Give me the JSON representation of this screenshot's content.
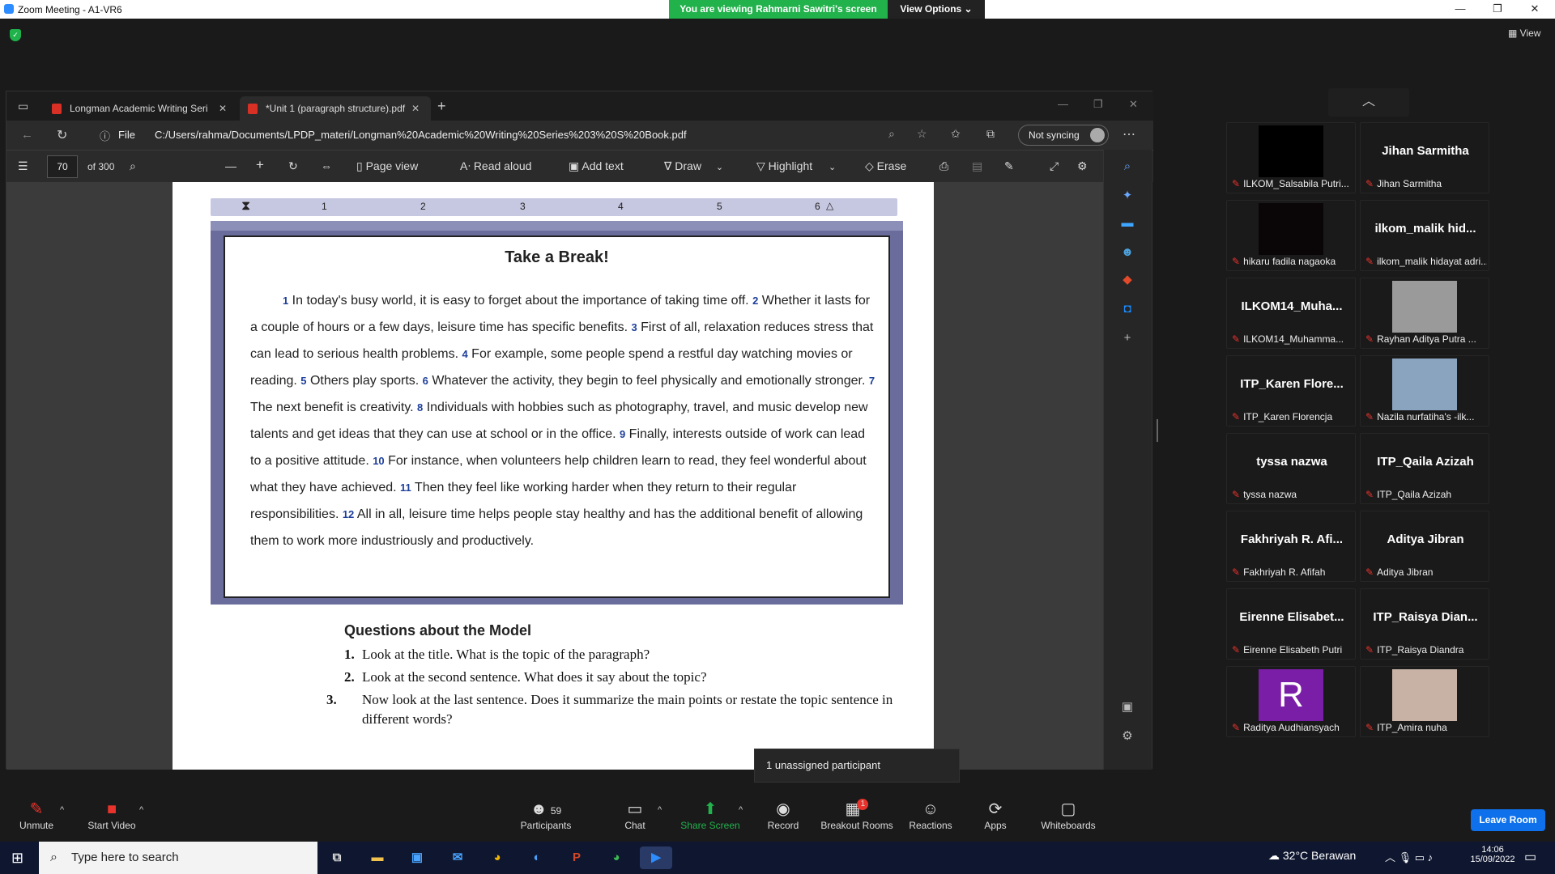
{
  "window": {
    "title": "Zoom Meeting - A1-VR6",
    "banner": "You are viewing Rahmarni Sawitri's screen",
    "view_options": "View Options ⌄",
    "view": "View"
  },
  "browser": {
    "tabs": [
      {
        "label": "Longman Academic Writing Seri"
      },
      {
        "label": "*Unit 1 (paragraph structure).pdf"
      }
    ],
    "file_label": "File",
    "url": "C:/Users/rahma/Documents/LPDP_materi/Longman%20Academic%20Writing%20Series%203%20S%20Book.pdf",
    "sync": "Not syncing",
    "page_num": "70",
    "page_of": "of 300",
    "tools": {
      "page_view": "Page view",
      "read_aloud": "Read aloud",
      "add_text": "Add text",
      "draw": "Draw",
      "highlight": "Highlight",
      "erase": "Erase"
    }
  },
  "doc": {
    "ruler_marks": [
      "1",
      "2",
      "3",
      "4",
      "5",
      "6"
    ],
    "title": "Take a Break!",
    "sentences": [
      {
        "n": "1",
        "t": " In today's busy world, it is easy to forget about the importance of taking time off. "
      },
      {
        "n": "2",
        "t": " Whether it lasts for a couple of hours or a few days, leisure time has specific benefits. "
      },
      {
        "n": "3",
        "t": " First of all, relaxation reduces stress that can lead to serious health problems. "
      },
      {
        "n": "4",
        "t": " For example, some people spend a restful day watching movies or reading. "
      },
      {
        "n": "5",
        "t": " Others play sports. "
      },
      {
        "n": "6",
        "t": " Whatever the activity, they begin to feel physically and emotionally stronger. "
      },
      {
        "n": "7",
        "t": " The next benefit is creativity. "
      },
      {
        "n": "8",
        "t": " Individuals with hobbies such as photography, travel, and music develop new talents and get ideas that they can use at school or in the office. "
      },
      {
        "n": "9",
        "t": " Finally, interests outside of work can lead to a positive attitude. "
      },
      {
        "n": "10",
        "t": " For instance, when volunteers help children learn to read, they feel wonderful about what they have achieved. "
      },
      {
        "n": "11",
        "t": " Then they feel like working harder when they return to their regular responsibilities. "
      },
      {
        "n": "12",
        "t": " All in all, leisure time helps people stay healthy and has the additional benefit of allowing them to work more industriously and productively."
      }
    ],
    "questions_heading": "Questions about the Model",
    "questions": [
      {
        "n": "1.",
        "t": "Look at the title. What is the topic of the paragraph?"
      },
      {
        "n": "2.",
        "t": "Look at the second sentence. What does it say about the topic?"
      },
      {
        "n": "3.",
        "t": "Now look at the last sentence. Does it summarize the main points or restate the topic sentence in different words?"
      }
    ]
  },
  "participants": [
    {
      "name": "",
      "label": "ILKOM_Salsabila Putri...",
      "video": "#000000"
    },
    {
      "name": "Jihan Sarmitha",
      "label": "Jihan Sarmitha"
    },
    {
      "name": "",
      "label": "hikaru fadila nagaoka",
      "video": "#0a0506"
    },
    {
      "name": "ilkom_malik hid...",
      "label": "ilkom_malik hidayat adri..."
    },
    {
      "name": "ILKOM14_Muha...",
      "label": "ILKOM14_Muhamma..."
    },
    {
      "name": "",
      "label": "Rayhan Aditya Putra ...",
      "video": "#9a9a9a"
    },
    {
      "name": "ITP_Karen Flore...",
      "label": "ITP_Karen Florencja"
    },
    {
      "name": "",
      "label": "Nazila nurfatiha's -ilk...",
      "video": "#8aa4c0"
    },
    {
      "name": "tyssa nazwa",
      "label": "tyssa nazwa"
    },
    {
      "name": "ITP_Qaila Azizah",
      "label": "ITP_Qaila Azizah"
    },
    {
      "name": "Fakhriyah R. Afi...",
      "label": "Fakhriyah R. Afifah"
    },
    {
      "name": "Aditya Jibran",
      "label": "Aditya Jibran"
    },
    {
      "name": "Eirenne Elisabet...",
      "label": "Eirenne Elisabeth Putri"
    },
    {
      "name": "ITP_Raisya Dian...",
      "label": "ITP_Raisya Diandra"
    },
    {
      "name": "",
      "label": "Raditya Audhiansyach",
      "avatar": "R",
      "video": "#7a1ea8"
    },
    {
      "name": "",
      "label": "ITP_Amira nuha",
      "video": "#c8b2a6"
    }
  ],
  "toolbar": {
    "unmute": "Unmute",
    "start_video": "Start Video",
    "participants": "Participants",
    "participants_count": "59",
    "chat": "Chat",
    "share": "Share Screen",
    "record": "Record",
    "breakout": "Breakout Rooms",
    "breakout_badge": "1",
    "reactions": "Reactions",
    "apps": "Apps",
    "whiteboards": "Whiteboards",
    "leave": "Leave Room",
    "tooltip": "1 unassigned participant"
  },
  "taskbar": {
    "search_placeholder": "Type here to search",
    "weather": "32°C  Berawan",
    "time": "14:06",
    "date": "15/09/2022"
  }
}
